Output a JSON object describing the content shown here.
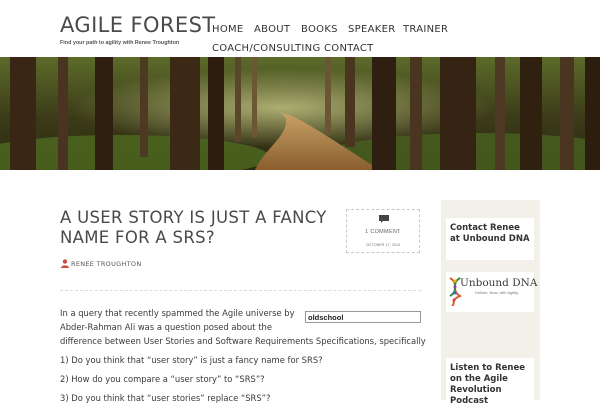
{
  "site": {
    "title": "AGILE FOREST",
    "tagline": "Find your path to agility with Renee Troughton"
  },
  "nav": {
    "items": [
      "HOME",
      "ABOUT",
      "BOOKS",
      "SPEAKER",
      "TRAINER",
      "COACH/CONSULTING",
      "CONTACT"
    ]
  },
  "banner": {
    "icon": "forest-path-image"
  },
  "post": {
    "title": "A USER STORY IS JUST A FANCY NAME FOR A SRS?",
    "comments": "1 COMMENT",
    "date": "OCTOBER 17, 2014",
    "author": "RENEE TROUGHTON",
    "image_alt": "oldschool",
    "body": [
      "In a query that recently spammed the Agile universe by",
      "Abder-Rahman Ali was a question posed about the",
      "difference between User Stories and Software Requirements Specifications, specifically",
      "1) Do you think that “user story” is just a fancy name for SRS?",
      "2) How do you compare a “user story” to “SRS”?",
      "3) Do you think that “user stories” replace “SRS”?"
    ]
  },
  "sidebar": {
    "widget1": {
      "title": "Contact Renee at Unbound DNA"
    },
    "logo": {
      "text": "Unbound DNA",
      "tagline": "Deliver. Now. with Agility."
    },
    "widget2": {
      "title": "Listen to Renee on the Agile Revolution Podcast"
    }
  },
  "colors": {
    "accent": "#c9503f",
    "sidebar_bg": "#f3efe9",
    "text": "#4a4a4a"
  }
}
